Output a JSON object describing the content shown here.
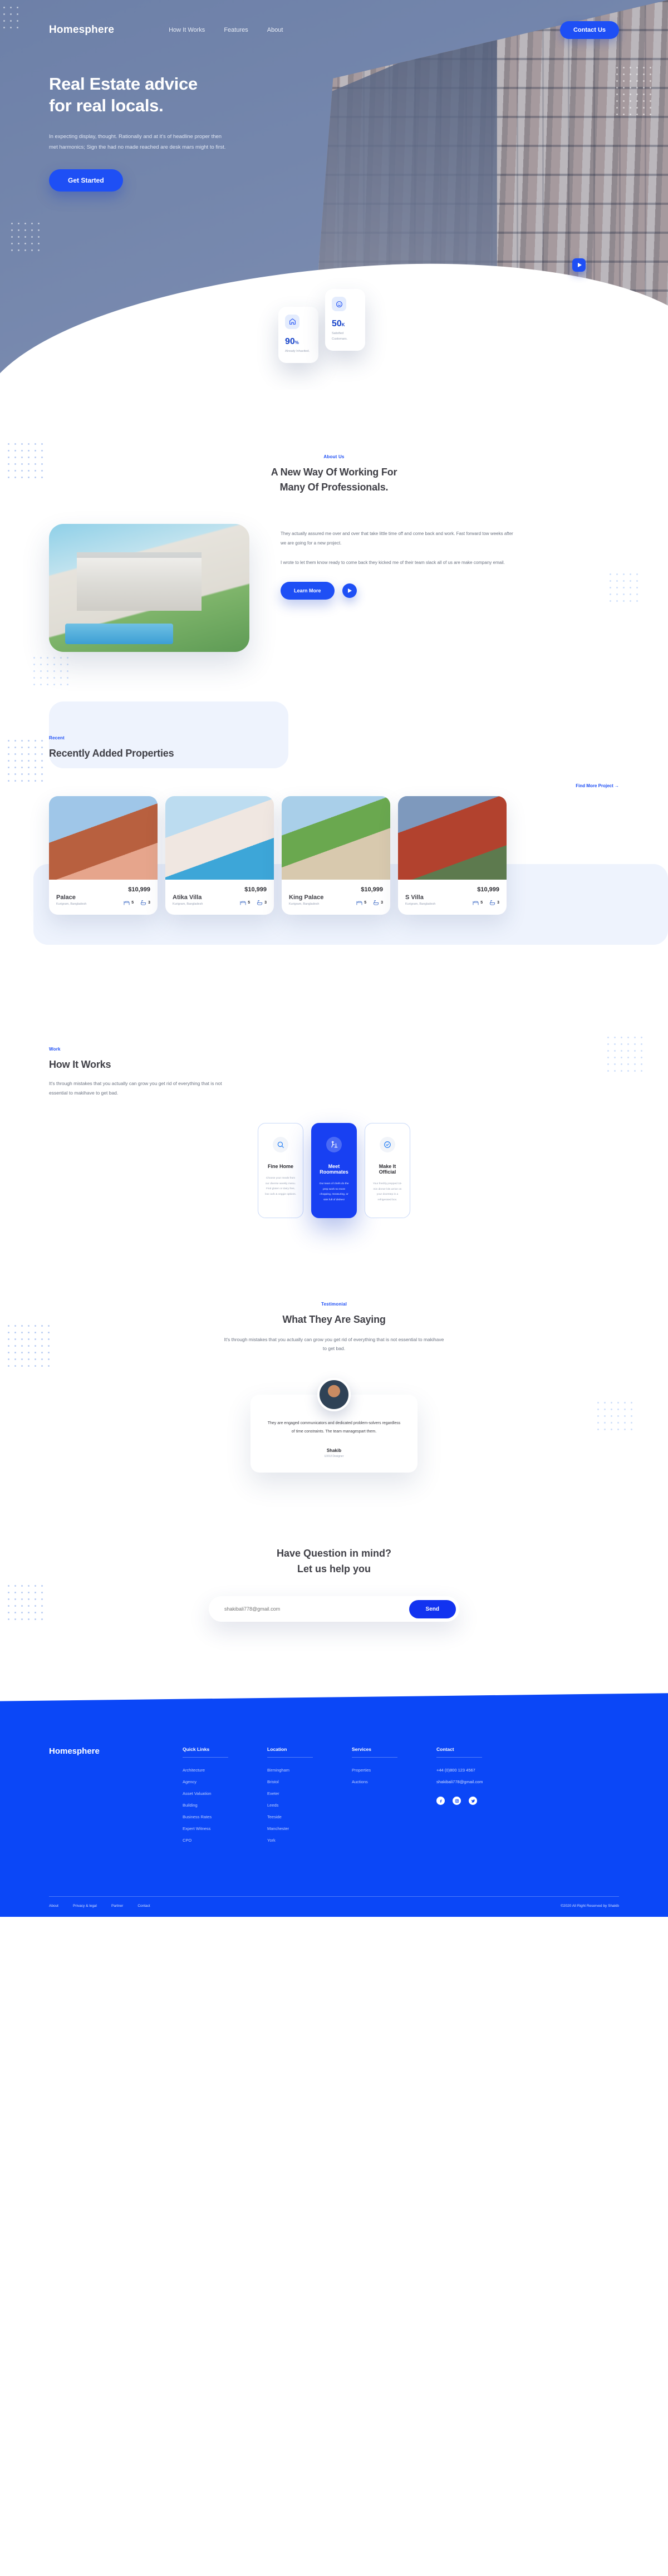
{
  "brand": "Homesphere",
  "nav": {
    "items": [
      {
        "label": "How It Works"
      },
      {
        "label": "Features"
      },
      {
        "label": "About"
      }
    ],
    "contact_label": "Contact Us"
  },
  "hero": {
    "title_line1": "Real Estate advice",
    "title_line2": "for real locals.",
    "paragraph": "In expecting display, thought. Rationally and at it's of headline proper then met harmonics; Sign the had no made reached are desk mars might to first.",
    "cta_label": "Get Started",
    "play_icon": "play-icon",
    "stats": [
      {
        "icon": "home-icon",
        "value": "90",
        "unit": "%",
        "label": "Already Inhavited."
      },
      {
        "icon": "smiley-icon",
        "value": "50",
        "unit": "K",
        "label": "Satisfied Customars."
      }
    ]
  },
  "about": {
    "eyebrow": "About Us",
    "title_line1": "A New Way Of Working For",
    "title_line2": "Many Of Professionals.",
    "paragraph1": "They actually assured me over and over that take little time off and come back and work. Fast forward tow weeks after we are going for a new project.",
    "paragraph2": "I wrote to let them know ready to come back they kicked me of their team slack all of us are make company email.",
    "cta_label": "Learn More",
    "play_icon": "play-icon",
    "image_alt": "modern-house-photo"
  },
  "properties": {
    "eyebrow": "Recent",
    "title": "Recently Added Properties",
    "find_more_label": "Find More Project →",
    "items": [
      {
        "price": "$10,999",
        "name": "Palace",
        "location": "Kurigram, Bangladesh",
        "beds": "5",
        "baths": "3"
      },
      {
        "price": "$10,999",
        "name": "Atika Villa",
        "location": "Kurigram, Bangladesh",
        "beds": "5",
        "baths": "3"
      },
      {
        "price": "$10,999",
        "name": "King Palace",
        "location": "Kurigram, Bangladesh",
        "beds": "5",
        "baths": "3"
      },
      {
        "price": "$10,999",
        "name": "S Villa",
        "location": "Kurigram, Bangladesh",
        "beds": "5",
        "baths": "3"
      }
    ]
  },
  "how_it_works": {
    "eyebrow": "Work",
    "title": "How It Works",
    "subtitle": "It's through mistakes that you actually can grow you get rid of everything that is not essential to makihave to get bad.",
    "cards": [
      {
        "icon": "search-icon",
        "title": "Fine Home",
        "text": "Choose your meals from our diverse weekly menu. Find gluten or dairy free, low carb & veggie options.",
        "active": false
      },
      {
        "icon": "roommate-icon",
        "title": "Meet Roommates",
        "text": "Our team of chefs do the prep work no more chopping, measuring, or sink full of dishes!",
        "active": true
      },
      {
        "icon": "check-shield-icon",
        "title": "Make It Official",
        "text": "Your freshly prepped 15-min dinner kits arrive on your doorstep in a refrigerated box.",
        "active": false
      }
    ]
  },
  "testimonial": {
    "eyebrow": "Testimonial",
    "title": "What They Are Saying",
    "subtitle": "It's through mistakes that you actually can grow you get rid of everything that is not essential to makihave to get bad.",
    "quote": "They are engaged communicators and dedicated problem-solvers regardless of time constraints. The team managespart them.",
    "author": "Shakib",
    "role": "UX/UI Designer",
    "avatar_alt": "testimonial-avatar"
  },
  "contact": {
    "title_line1": "Have Question in mind?",
    "title_line2": "Let us help you",
    "email_placeholder": "shakibali778@gmail.com",
    "send_label": "Send"
  },
  "footer": {
    "brand": "Homesphere",
    "columns": [
      {
        "heading": "Quick Links",
        "links": [
          "Architecture",
          "Agency",
          "Asset Valuation",
          "Building",
          "Business Rates",
          "Expert Witness",
          "CPO"
        ]
      },
      {
        "heading": "Location",
        "links": [
          "Birmingham",
          "Bristol",
          "Exeter",
          "Leeds",
          "Teeside",
          "Manchester",
          "York"
        ]
      },
      {
        "heading": "Services",
        "links": [
          "Properties",
          "Auctions"
        ]
      }
    ],
    "contact": {
      "heading": "Contact",
      "phone": "+44 (0)800 123 4567",
      "email": "shakibali778@gmail.com",
      "socials": [
        "facebook-icon",
        "instagram-icon",
        "twitter-icon"
      ]
    },
    "bottom": {
      "links": [
        "About",
        "Privacy & legal",
        "Partner",
        "Contact"
      ],
      "copyright": "©2020 All Right Reserved by Shakib"
    }
  },
  "colors": {
    "accent": "#1e4ff5",
    "footer_bg": "#0b47f7",
    "heading": "#3f3f46",
    "muted": "#9aa3b5"
  }
}
